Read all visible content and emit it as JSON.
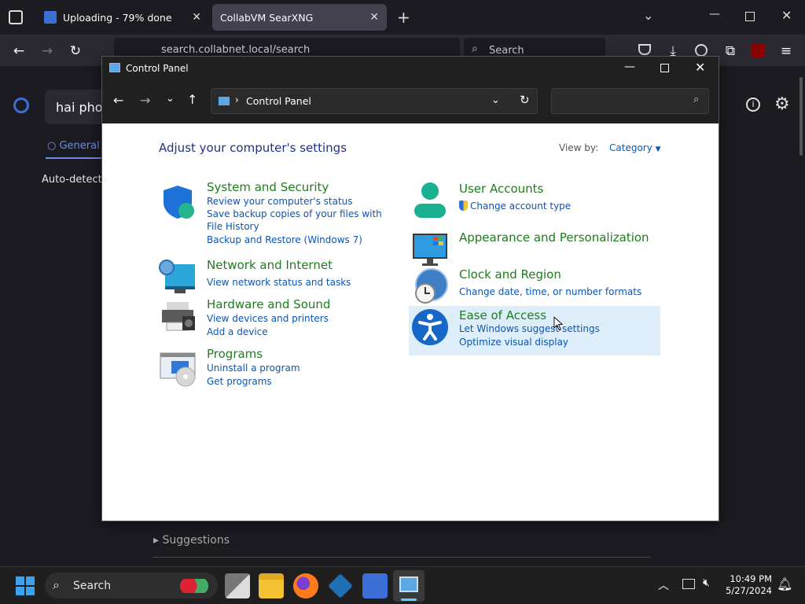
{
  "browser": {
    "tabs": [
      {
        "label": "Uploading - 79% done",
        "active": false
      },
      {
        "label": "CollabVM SearXNG",
        "active": true
      }
    ],
    "url": "search.collabnet.local/search",
    "search_placeholder": "Search",
    "accent": "#42414d"
  },
  "page_behind": {
    "query": "hai phon",
    "tab_general": "General",
    "autodetect": "Auto-detect (",
    "suggestions": "Suggestions"
  },
  "control_panel": {
    "title": "Control Panel",
    "address": "Control Panel",
    "heading": "Adjust your computer's settings",
    "view_by_label": "View by:",
    "view_by_value": "Category",
    "categories_left": [
      {
        "title": "System and Security",
        "links": [
          "Review your computer's status",
          "Save backup copies of your files with File History",
          "Backup and Restore (Windows 7)"
        ]
      },
      {
        "title": "Network and Internet",
        "links": [
          "View network status and tasks"
        ]
      },
      {
        "title": "Hardware and Sound",
        "links": [
          "View devices and printers",
          "Add a device"
        ]
      },
      {
        "title": "Programs",
        "links": [
          "Uninstall a program",
          "Get programs"
        ]
      }
    ],
    "categories_right": [
      {
        "title": "User Accounts",
        "links": [
          "Change account type"
        ]
      },
      {
        "title": "Appearance and Personalization",
        "links": []
      },
      {
        "title": "Clock and Region",
        "links": [
          "Change date, time, or number formats"
        ]
      },
      {
        "title": "Ease of Access",
        "links": [
          "Let Windows suggest settings",
          "Optimize visual display"
        ]
      }
    ]
  },
  "taskbar": {
    "search_label": "Search",
    "time": "10:49 PM",
    "date": "5/27/2024"
  }
}
